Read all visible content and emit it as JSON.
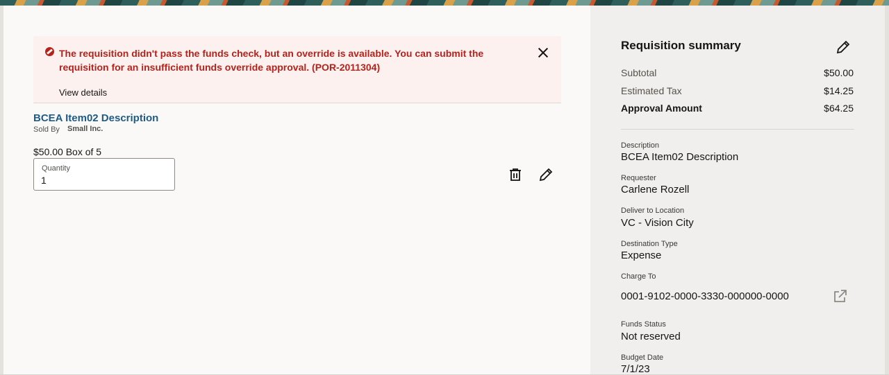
{
  "alert": {
    "message": "The requisition didn't pass the funds check, but an override is available. You can submit the requisition for an insufficient funds override approval. (POR-2011304)",
    "details_link": "View details"
  },
  "item": {
    "name": "BCEA Item02 Description",
    "sold_by_label": "Sold By",
    "seller": "Small Inc.",
    "price": "$50.00 Box of 5",
    "quantity_label": "Quantity",
    "quantity_value": "1"
  },
  "summary": {
    "title": "Requisition summary",
    "rows": [
      {
        "label": "Subtotal",
        "value": "$50.00"
      },
      {
        "label": "Estimated Tax",
        "value": "$14.25"
      },
      {
        "label": "Approval Amount",
        "value": "$64.25"
      }
    ],
    "fields": [
      {
        "label": "Description",
        "value": "BCEA Item02 Description"
      },
      {
        "label": "Requester",
        "value": "Carlene Rozell"
      },
      {
        "label": "Deliver to Location",
        "value": "VC - Vision City"
      },
      {
        "label": "Destination Type",
        "value": "Expense"
      },
      {
        "label": "Charge To",
        "value": "0001-9102-0000-3330-000000-0000"
      },
      {
        "label": "Funds Status",
        "value": "Not reserved"
      },
      {
        "label": "Budget Date",
        "value": "7/1/23"
      }
    ]
  },
  "colors": {
    "error": "#b3231c",
    "error_bg": "#fdf1ef",
    "link": "#1e5b86",
    "sidebar_bg": "#f1efed",
    "main_bg": "#fbf9f8"
  },
  "icons": [
    "error-icon",
    "close-icon",
    "trash-icon",
    "pencil-icon",
    "external-link-icon"
  ]
}
